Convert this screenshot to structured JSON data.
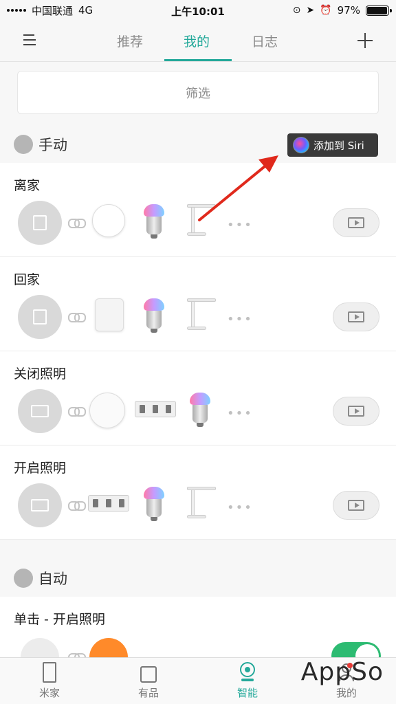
{
  "status_bar": {
    "carrier": "中国联通",
    "network": "4G",
    "time": "上午10:01",
    "battery_text": "97%",
    "battery_level": 0.97
  },
  "header": {
    "menu_icon": "menu-icon",
    "tabs": [
      {
        "label": "推荐",
        "active": false
      },
      {
        "label": "我的",
        "active": true
      },
      {
        "label": "日志",
        "active": false
      }
    ],
    "add_icon": "plus-icon"
  },
  "filter": {
    "label": "筛选"
  },
  "manual_section": {
    "title": "手动",
    "siri_button": "添加到 Siri"
  },
  "scenes": [
    {
      "title": "离家",
      "devices": [
        "plug",
        "bulb",
        "lamp"
      ]
    },
    {
      "title": "回家",
      "devices": [
        "socket",
        "bulb",
        "lamp"
      ]
    },
    {
      "title": "关闭照明",
      "devices": [
        "gateway",
        "strip",
        "bulb"
      ]
    },
    {
      "title": "开启照明",
      "devices": [
        "strip",
        "bulb",
        "lamp"
      ]
    }
  ],
  "auto_section": {
    "title": "自动",
    "items": [
      {
        "title": "单击 - 开启照明",
        "enabled": true
      }
    ]
  },
  "tabbar": {
    "items": [
      {
        "label": "米家",
        "icon": "door-icon",
        "active": false
      },
      {
        "label": "有品",
        "icon": "shopping-bag-icon",
        "active": false
      },
      {
        "label": "智能",
        "icon": "camera-icon",
        "active": true
      },
      {
        "label": "我的",
        "icon": "user-icon",
        "active": false
      }
    ]
  },
  "watermark": "AppSo",
  "colors": {
    "accent": "#24a99a",
    "arrow": "#e0291c",
    "toggle_on": "#2dbb72"
  }
}
